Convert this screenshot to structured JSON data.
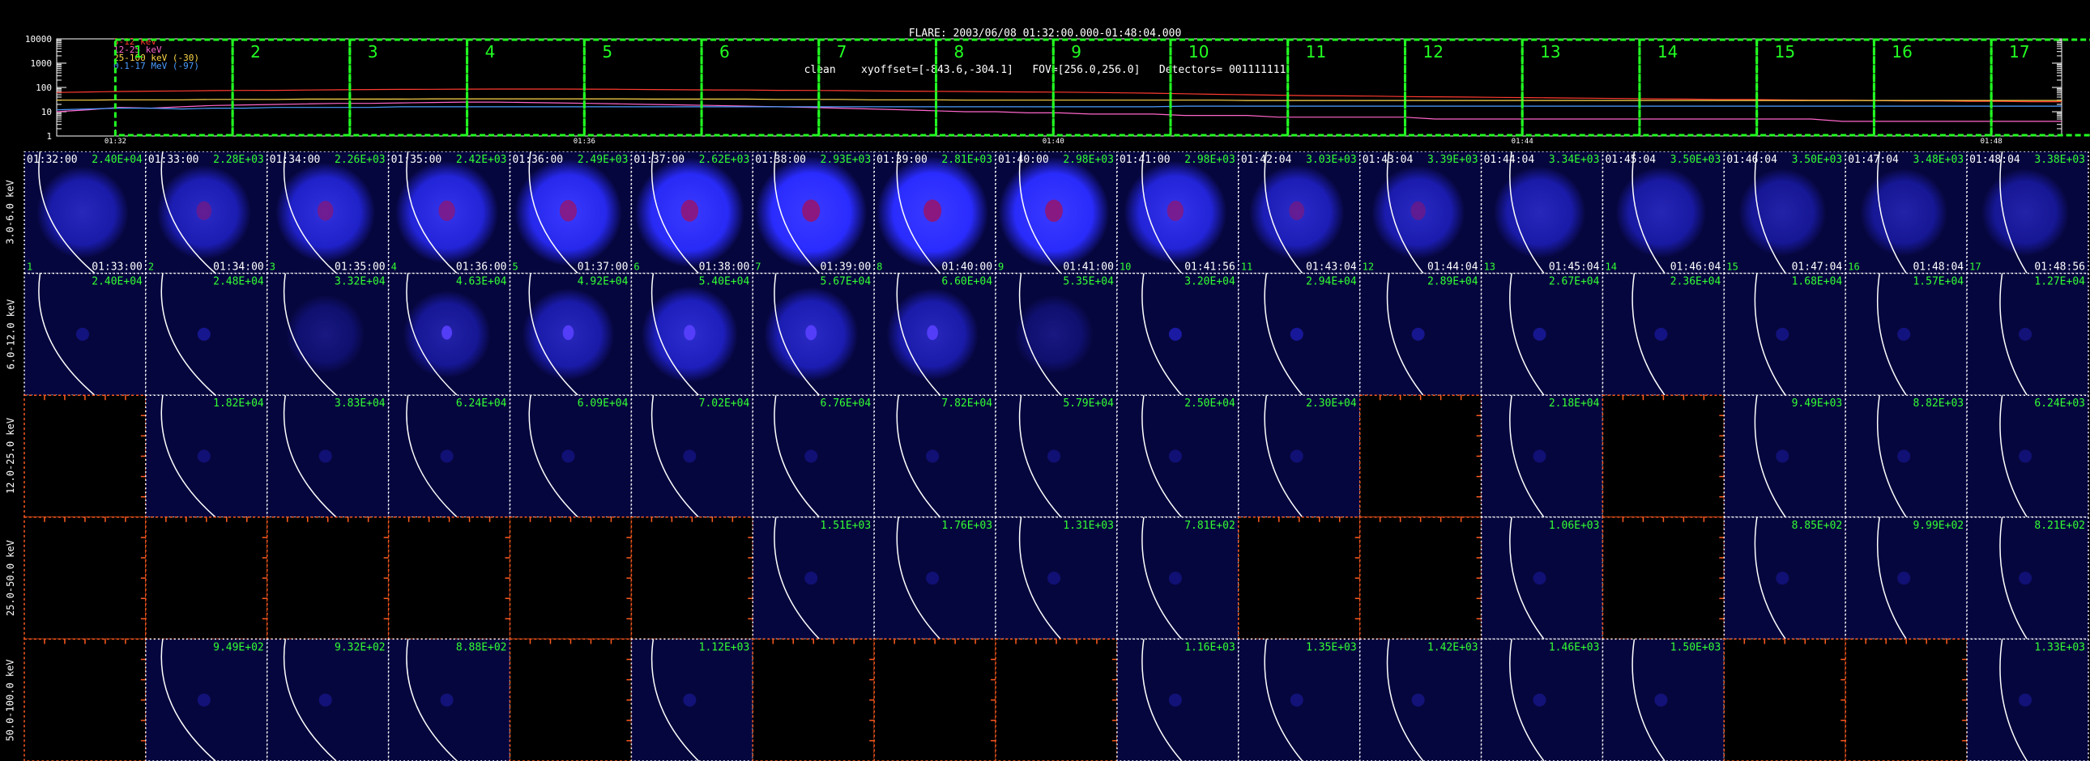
{
  "header": {
    "title": "FLARE: 2003/06/08 01:32:00.000-01:48:04.000",
    "info": "clean    xyoffset=[-843.6,-304.1]   FOV=[256.0,256.0]   Detectors= 001111111"
  },
  "chart_data": [
    {
      "type": "line",
      "scale": "log",
      "ylim": [
        1,
        10000
      ],
      "yticks": [
        "10000",
        "1000",
        "100",
        "10",
        "1"
      ],
      "xlim_min": [
        1.5,
        18.6
      ],
      "xticks": [
        {
          "t": 2.0,
          "label": "01:32"
        },
        {
          "t": 6.0,
          "label": "01:36"
        },
        {
          "t": 10.0,
          "label": "01:40"
        },
        {
          "t": 14.0,
          "label": "01:44"
        },
        {
          "t": 18.0,
          "label": "01:48"
        }
      ],
      "series": [
        {
          "name": "3-12 keV",
          "color": "#ff3b30",
          "values": [
            62,
            65,
            68,
            70,
            72,
            74,
            75,
            76,
            78,
            80,
            82,
            83,
            84,
            85,
            86,
            86,
            86,
            85,
            84,
            82,
            80,
            79,
            78,
            76,
            75,
            74,
            72,
            70,
            69,
            68,
            66,
            65,
            64,
            62,
            60,
            58,
            55,
            52,
            50,
            48,
            46,
            45,
            44,
            42,
            41,
            40,
            39,
            38,
            37,
            36,
            35,
            34,
            33,
            32,
            32,
            31,
            30,
            30,
            29,
            28,
            28,
            27,
            27,
            26,
            26
          ]
        },
        {
          "name": "12-25 keV",
          "color": "#ff66cc",
          "values": [
            10,
            12,
            15,
            14,
            16,
            18,
            19,
            20,
            21,
            22,
            22,
            23,
            24,
            25,
            25,
            24,
            23,
            22,
            21,
            20,
            19,
            18,
            17,
            16,
            15,
            14,
            13,
            12,
            11,
            10,
            10,
            9,
            9,
            8,
            8,
            8,
            7,
            7,
            7,
            6,
            6,
            6,
            6,
            6,
            5,
            5,
            5,
            5,
            5,
            5,
            5,
            5,
            5,
            5,
            5,
            5,
            5,
            4,
            4,
            4,
            4,
            4,
            4,
            4,
            4
          ]
        },
        {
          "name": "25-100 keV (-30)",
          "color": "#ffd84a",
          "values": [
            30,
            30,
            31,
            31,
            31,
            32,
            32,
            32,
            33,
            33,
            33,
            33,
            34,
            34,
            34,
            34,
            34,
            34,
            34,
            33,
            33,
            33,
            33,
            32,
            32,
            32,
            31,
            31,
            31,
            30,
            30,
            30,
            30,
            30,
            30,
            30,
            30,
            30,
            29,
            29,
            29,
            29,
            29,
            29,
            29,
            29,
            29,
            29,
            29,
            29,
            29,
            29,
            29,
            29,
            29,
            29,
            29,
            29,
            29,
            29,
            29,
            29,
            29,
            29,
            29
          ]
        },
        {
          "name": "0.1-17 MeV (-97)",
          "color": "#4b9cff",
          "values": [
            12,
            13,
            14,
            14,
            13,
            14,
            14,
            15,
            15,
            15,
            15,
            16,
            16,
            16,
            16,
            16,
            16,
            16,
            16,
            16,
            16,
            16,
            16,
            16,
            16,
            16,
            16,
            16,
            16,
            16,
            16,
            16,
            16,
            16,
            16,
            16,
            17,
            17,
            17,
            17,
            17,
            17,
            17,
            17,
            17,
            17,
            17,
            17,
            17,
            17,
            17,
            17,
            17,
            17,
            17,
            17,
            17,
            17,
            17,
            17,
            17,
            17,
            17,
            17,
            17
          ]
        }
      ],
      "intervals": [
        "1",
        "2",
        "3",
        "4",
        "5",
        "6",
        "7",
        "8",
        "9",
        "10",
        "11",
        "12",
        "13",
        "14",
        "15",
        "16",
        "17"
      ]
    },
    {
      "type": "heatmap",
      "bands": [
        "3.0-6.0 keV",
        "6.0-12.0 keV",
        "12.0-25.0 keV",
        "25.0-50.0 keV",
        "50.0-100.0 keV"
      ],
      "interval_numbers": [
        "1",
        "2",
        "3",
        "4",
        "5",
        "6",
        "7",
        "8",
        "9",
        "10",
        "11",
        "12",
        "13",
        "14",
        "15",
        "16",
        "17"
      ],
      "start_times": [
        "01:32:00",
        "01:33:00",
        "01:34:00",
        "01:35:00",
        "01:36:00",
        "01:37:00",
        "01:38:00",
        "01:39:00",
        "01:40:00",
        "01:41:00",
        "01:42:04",
        "01:43:04",
        "01:44:04",
        "01:45:04",
        "01:46:04",
        "01:47:04",
        "01:48:04"
      ],
      "end_times": [
        "01:33:00",
        "01:34:00",
        "01:35:00",
        "01:36:00",
        "01:37:00",
        "01:38:00",
        "01:39:00",
        "01:40:00",
        "01:41:00",
        "01:41:56",
        "01:43:04",
        "01:44:04",
        "01:45:04",
        "01:46:04",
        "01:47:04",
        "01:48:04",
        "01:48:56"
      ],
      "peaks": [
        [
          "2.40E+04",
          "2.28E+03",
          "2.26E+03",
          "2.42E+03",
          "2.49E+03",
          "2.62E+03",
          "2.93E+03",
          "2.81E+03",
          "2.98E+03",
          "2.98E+03",
          "3.03E+03",
          "3.39E+03",
          "3.34E+03",
          "3.50E+03",
          "3.50E+03",
          "3.48E+03",
          "3.38E+03"
        ],
        [
          "2.40E+04",
          "2.48E+04",
          "3.32E+04",
          "4.63E+04",
          "4.92E+04",
          "5.40E+04",
          "5.67E+04",
          "6.60E+04",
          "5.35E+04",
          "3.20E+04",
          "2.94E+04",
          "2.89E+04",
          "2.67E+04",
          "2.36E+04",
          "1.68E+04",
          "1.57E+04",
          "1.27E+04"
        ],
        [
          "",
          "1.82E+04",
          "3.83E+04",
          "6.24E+04",
          "6.09E+04",
          "7.02E+04",
          "6.76E+04",
          "7.82E+04",
          "5.79E+04",
          "2.50E+04",
          "2.30E+04",
          "",
          "2.18E+04",
          "",
          "9.49E+03",
          "8.82E+03",
          "6.24E+03"
        ],
        [
          "",
          "",
          "",
          "",
          "",
          "",
          "1.51E+03",
          "1.76E+03",
          "1.31E+03",
          "7.81E+02",
          "",
          "",
          "1.06E+03",
          "",
          "8.85E+02",
          "9.99E+02",
          "8.21E+02"
        ],
        [
          "",
          "9.49E+02",
          "9.32E+02",
          "8.88E+02",
          "",
          "1.12E+03",
          "",
          "",
          "",
          "1.16E+03",
          "1.35E+03",
          "1.42E+03",
          "1.46E+03",
          "1.50E+03",
          "",
          "",
          "1.33E+03"
        ]
      ],
      "intensity": [
        [
          0.55,
          0.6,
          0.72,
          0.8,
          0.9,
          0.95,
          1.0,
          1.0,
          0.98,
          0.8,
          0.62,
          0.58,
          0.55,
          0.52,
          0.45,
          0.45,
          0.45
        ],
        [
          0.05,
          0.08,
          0.25,
          0.45,
          0.55,
          0.65,
          0.6,
          0.55,
          0.25,
          0.12,
          0.1,
          0.08,
          0.08,
          0.06,
          0.05,
          0.05,
          0.04
        ],
        [
          0,
          0.03,
          0.03,
          0.03,
          0.03,
          0.03,
          0.03,
          0.03,
          0.03,
          0.03,
          0.03,
          0,
          0.03,
          0,
          0.03,
          0.03,
          0.03
        ],
        [
          0,
          0,
          0,
          0,
          0,
          0,
          0.03,
          0.03,
          0.03,
          0.03,
          0,
          0,
          0.03,
          0,
          0.03,
          0.03,
          0.03
        ],
        [
          0,
          0.04,
          0.04,
          0.04,
          0,
          0.04,
          0,
          0,
          0,
          0.04,
          0.04,
          0.04,
          0.04,
          0.04,
          0,
          0,
          0.04
        ]
      ],
      "empty_panels": [
        [
          2,
          0
        ],
        [
          2,
          11
        ],
        [
          2,
          13
        ],
        [
          3,
          0
        ],
        [
          3,
          1
        ],
        [
          3,
          2
        ],
        [
          3,
          3
        ],
        [
          3,
          4
        ],
        [
          3,
          5
        ],
        [
          3,
          10
        ],
        [
          3,
          11
        ],
        [
          3,
          13
        ],
        [
          4,
          0
        ],
        [
          4,
          4
        ],
        [
          4,
          6
        ],
        [
          4,
          7
        ],
        [
          4,
          8
        ],
        [
          4,
          14
        ],
        [
          4,
          15
        ]
      ],
      "colors": {
        "disk": "#2a2cff",
        "core": "#a01060",
        "background": "#06063e",
        "grid": "#ffffff",
        "empty_border": "#ff5a1f",
        "label": "#33ff33",
        "limb": "#ffffff"
      }
    }
  ]
}
